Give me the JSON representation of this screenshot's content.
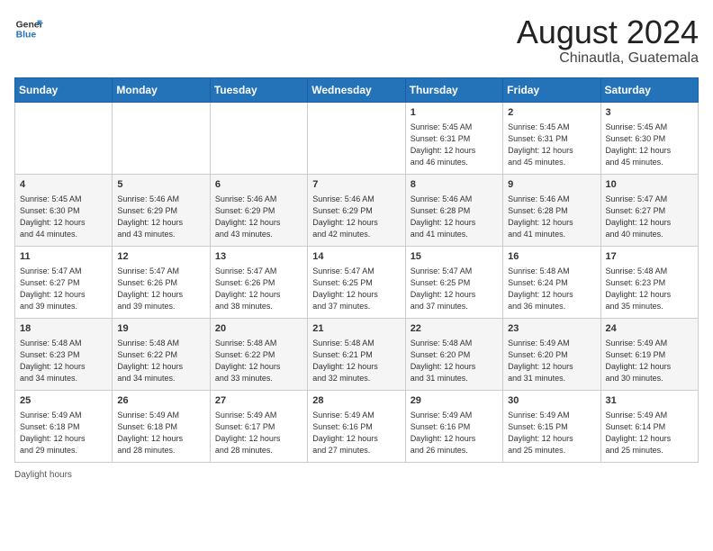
{
  "header": {
    "logo_line1": "General",
    "logo_line2": "Blue",
    "month_year": "August 2024",
    "location": "Chinautla, Guatemala"
  },
  "days_of_week": [
    "Sunday",
    "Monday",
    "Tuesday",
    "Wednesday",
    "Thursday",
    "Friday",
    "Saturday"
  ],
  "weeks": [
    [
      {
        "day": "",
        "info": ""
      },
      {
        "day": "",
        "info": ""
      },
      {
        "day": "",
        "info": ""
      },
      {
        "day": "",
        "info": ""
      },
      {
        "day": "1",
        "info": "Sunrise: 5:45 AM\nSunset: 6:31 PM\nDaylight: 12 hours\nand 46 minutes."
      },
      {
        "day": "2",
        "info": "Sunrise: 5:45 AM\nSunset: 6:31 PM\nDaylight: 12 hours\nand 45 minutes."
      },
      {
        "day": "3",
        "info": "Sunrise: 5:45 AM\nSunset: 6:30 PM\nDaylight: 12 hours\nand 45 minutes."
      }
    ],
    [
      {
        "day": "4",
        "info": "Sunrise: 5:45 AM\nSunset: 6:30 PM\nDaylight: 12 hours\nand 44 minutes."
      },
      {
        "day": "5",
        "info": "Sunrise: 5:46 AM\nSunset: 6:29 PM\nDaylight: 12 hours\nand 43 minutes."
      },
      {
        "day": "6",
        "info": "Sunrise: 5:46 AM\nSunset: 6:29 PM\nDaylight: 12 hours\nand 43 minutes."
      },
      {
        "day": "7",
        "info": "Sunrise: 5:46 AM\nSunset: 6:29 PM\nDaylight: 12 hours\nand 42 minutes."
      },
      {
        "day": "8",
        "info": "Sunrise: 5:46 AM\nSunset: 6:28 PM\nDaylight: 12 hours\nand 41 minutes."
      },
      {
        "day": "9",
        "info": "Sunrise: 5:46 AM\nSunset: 6:28 PM\nDaylight: 12 hours\nand 41 minutes."
      },
      {
        "day": "10",
        "info": "Sunrise: 5:47 AM\nSunset: 6:27 PM\nDaylight: 12 hours\nand 40 minutes."
      }
    ],
    [
      {
        "day": "11",
        "info": "Sunrise: 5:47 AM\nSunset: 6:27 PM\nDaylight: 12 hours\nand 39 minutes."
      },
      {
        "day": "12",
        "info": "Sunrise: 5:47 AM\nSunset: 6:26 PM\nDaylight: 12 hours\nand 39 minutes."
      },
      {
        "day": "13",
        "info": "Sunrise: 5:47 AM\nSunset: 6:26 PM\nDaylight: 12 hours\nand 38 minutes."
      },
      {
        "day": "14",
        "info": "Sunrise: 5:47 AM\nSunset: 6:25 PM\nDaylight: 12 hours\nand 37 minutes."
      },
      {
        "day": "15",
        "info": "Sunrise: 5:47 AM\nSunset: 6:25 PM\nDaylight: 12 hours\nand 37 minutes."
      },
      {
        "day": "16",
        "info": "Sunrise: 5:48 AM\nSunset: 6:24 PM\nDaylight: 12 hours\nand 36 minutes."
      },
      {
        "day": "17",
        "info": "Sunrise: 5:48 AM\nSunset: 6:23 PM\nDaylight: 12 hours\nand 35 minutes."
      }
    ],
    [
      {
        "day": "18",
        "info": "Sunrise: 5:48 AM\nSunset: 6:23 PM\nDaylight: 12 hours\nand 34 minutes."
      },
      {
        "day": "19",
        "info": "Sunrise: 5:48 AM\nSunset: 6:22 PM\nDaylight: 12 hours\nand 34 minutes."
      },
      {
        "day": "20",
        "info": "Sunrise: 5:48 AM\nSunset: 6:22 PM\nDaylight: 12 hours\nand 33 minutes."
      },
      {
        "day": "21",
        "info": "Sunrise: 5:48 AM\nSunset: 6:21 PM\nDaylight: 12 hours\nand 32 minutes."
      },
      {
        "day": "22",
        "info": "Sunrise: 5:48 AM\nSunset: 6:20 PM\nDaylight: 12 hours\nand 31 minutes."
      },
      {
        "day": "23",
        "info": "Sunrise: 5:49 AM\nSunset: 6:20 PM\nDaylight: 12 hours\nand 31 minutes."
      },
      {
        "day": "24",
        "info": "Sunrise: 5:49 AM\nSunset: 6:19 PM\nDaylight: 12 hours\nand 30 minutes."
      }
    ],
    [
      {
        "day": "25",
        "info": "Sunrise: 5:49 AM\nSunset: 6:18 PM\nDaylight: 12 hours\nand 29 minutes."
      },
      {
        "day": "26",
        "info": "Sunrise: 5:49 AM\nSunset: 6:18 PM\nDaylight: 12 hours\nand 28 minutes."
      },
      {
        "day": "27",
        "info": "Sunrise: 5:49 AM\nSunset: 6:17 PM\nDaylight: 12 hours\nand 28 minutes."
      },
      {
        "day": "28",
        "info": "Sunrise: 5:49 AM\nSunset: 6:16 PM\nDaylight: 12 hours\nand 27 minutes."
      },
      {
        "day": "29",
        "info": "Sunrise: 5:49 AM\nSunset: 6:16 PM\nDaylight: 12 hours\nand 26 minutes."
      },
      {
        "day": "30",
        "info": "Sunrise: 5:49 AM\nSunset: 6:15 PM\nDaylight: 12 hours\nand 25 minutes."
      },
      {
        "day": "31",
        "info": "Sunrise: 5:49 AM\nSunset: 6:14 PM\nDaylight: 12 hours\nand 25 minutes."
      }
    ]
  ],
  "footer": {
    "daylight_label": "Daylight hours"
  }
}
